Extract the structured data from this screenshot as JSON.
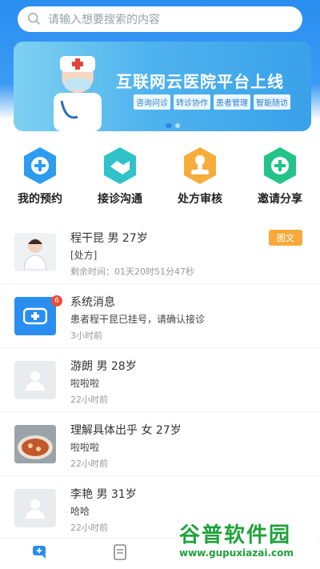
{
  "search": {
    "placeholder": "请输入想要搜索的内容"
  },
  "banner": {
    "title": "互联网云医院平台上线",
    "tags": [
      "咨询问诊",
      "转诊协作",
      "患者管理",
      "智能随访"
    ]
  },
  "quick_actions": [
    {
      "label": "我的预约",
      "icon": "plus-icon",
      "color": "#2d9cf0"
    },
    {
      "label": "接诊沟通",
      "icon": "handshake-icon",
      "color": "#2fc2c9"
    },
    {
      "label": "处方审核",
      "icon": "stamp-icon",
      "color": "#f6ad3a"
    },
    {
      "label": "邀请分享",
      "icon": "plus-icon",
      "color": "#23c38a"
    }
  ],
  "messages": [
    {
      "name": "程干昆 男 27岁",
      "sub": "[处方]",
      "time": "剩余时间：01天20时51分47秒",
      "badge": "图文",
      "avatar": "doctor-avatar"
    },
    {
      "name": "系统消息",
      "sub": "患者程干昆已挂号，请确认接诊",
      "time": "3小时前",
      "count": "6",
      "avatar": "system-icon"
    },
    {
      "name": "游朗 男 28岁",
      "sub": "啦啦啦",
      "time": "22小时前",
      "avatar": "user-placeholder"
    },
    {
      "name": "理解具体出乎 女 27岁",
      "sub": "啦啦啦",
      "time": "22小时前",
      "avatar": "food-photo"
    },
    {
      "name": "李艳 男 31岁",
      "sub": "哈哈",
      "time": "22小时前",
      "avatar": "user-placeholder"
    }
  ],
  "watermark": {
    "title": "谷普软件园",
    "url": "www.gupuxiazai.com"
  },
  "colors": {
    "primary": "#2a8ef0",
    "badge_orange": "#f7a93c",
    "count_red": "#f04a3a"
  }
}
